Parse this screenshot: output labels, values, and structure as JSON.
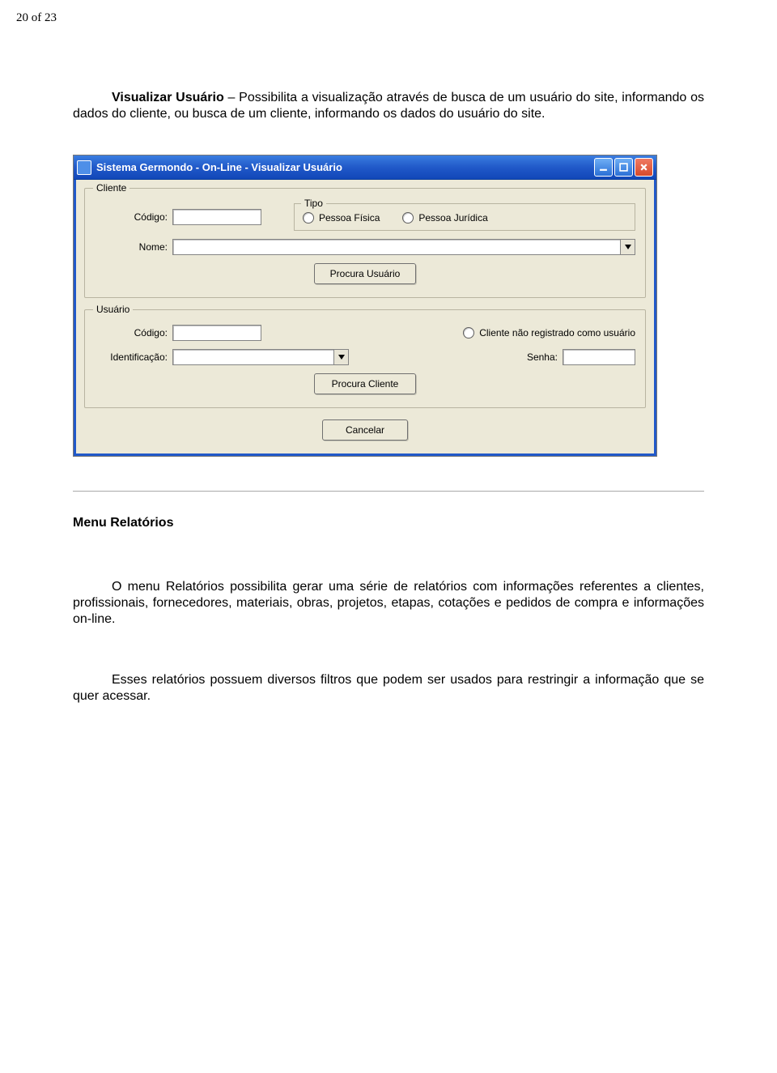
{
  "page_number": "20 of 23",
  "p1_bold": "Visualizar Usuário",
  "p1_rest": " – Possibilita a visualização através de busca de um usuário do site, informando os dados do cliente, ou busca de um cliente, informando os dados do usuário do site.",
  "section_menu": "Menu Relatórios",
  "p2": "O menu Relatórios possibilita gerar uma série de relatórios com informações referentes a clientes, profissionais, fornecedores, materiais, obras, projetos, etapas, cotações e pedidos de compra e informações on-line.",
  "p3": "Esses relatórios possuem diversos filtros que podem ser usados para restringir a informação que se quer acessar.",
  "win": {
    "title": "Sistema Germondo - On-Line - Visualizar Usuário",
    "group_cliente": "Cliente",
    "label_codigo": "Código:",
    "label_nome": "Nome:",
    "tipo_legend": "Tipo",
    "radio_pf": "Pessoa Física",
    "radio_pj": "Pessoa Jurídica",
    "btn_procura_usuario": "Procura Usuário",
    "group_usuario": "Usuário",
    "radio_nao_reg": "Cliente não registrado como usuário",
    "label_ident": "Identificação:",
    "label_senha": "Senha:",
    "btn_procura_cliente": "Procura Cliente",
    "btn_cancelar": "Cancelar"
  }
}
